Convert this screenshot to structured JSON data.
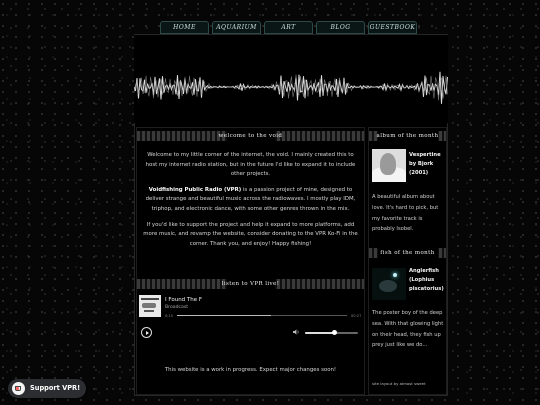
{
  "nav": {
    "items": [
      "HOME",
      "AQUARIUM",
      "ART",
      "BLOG",
      "GUESTBOOK"
    ]
  },
  "welcome": {
    "heading": "welcome to the void",
    "intro": "Welcome to my little corner of the internet, the void. I mainly created this to host my internet radio station, but in the future I'd like to expand it to include other projects.",
    "radio_name": "Voidfishing Public Radio (VPR)",
    "radio_text": " is a passion project of mine, designed to deliver strange and beautiful music across the radiowaves. I mostly play IDM, triphop, and electronic dance, with some other genres thrown in the mix.",
    "support_text": "If you'd like to support the project and help it expand to more platforms, add more music, and revamp the website, consider donating to the VPR Ko-Fi in the corner. Thank you, and enjoy! Happy fishing!"
  },
  "listen": {
    "heading": "listen to VPR live!",
    "track_title": "I Found The F",
    "track_artist": "Broadcast",
    "elapsed": "0:15",
    "duration": "00:27",
    "progress": 0.55,
    "volume": 0.55
  },
  "wip_notice": "This website is a work in progress. Expect major changes soon!",
  "album_of_month": {
    "heading": "album of the month",
    "title": "Vespertine by Bjork (2001)",
    "description": "A beautiful album about love. It's hard to pick, but my favorite track is probably Isobel."
  },
  "fish_of_month": {
    "heading": "fish of the month",
    "title": "Anglerfish (Lophius piscatorius)",
    "description": "The poster boy of the deep sea. With that glowing light on their head, they fish up prey just like we do..."
  },
  "credit": "site layout by almost sweet",
  "support_button": "Support VPR!",
  "colors": {
    "nav_bg": "#0a1616",
    "nav_border": "#2e4a48",
    "page_bg": "#060606"
  }
}
